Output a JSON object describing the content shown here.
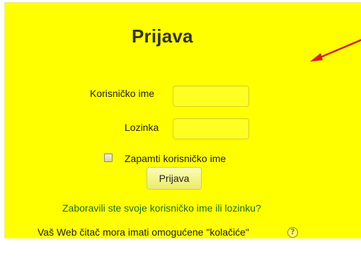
{
  "login": {
    "title": "Prijava",
    "username_label": "Korisničko ime",
    "username_value": "",
    "password_label": "Lozinka",
    "password_value": "",
    "remember_label": "Zapamti korisničko ime",
    "remember_checked": false,
    "submit_label": "Prijava",
    "forgot_link": "Zaboravili ste svoje korisničko ime ili lozinku?",
    "cookies_notice": "Vaš Web čitač mora imati omogućene \"kolačiće\""
  },
  "icons": {
    "help": "help-icon",
    "annotation": "red-arrow-icon"
  },
  "colors": {
    "panel_background": "#ffff00",
    "link": "#1f6f1f",
    "arrow": "#d42020"
  }
}
